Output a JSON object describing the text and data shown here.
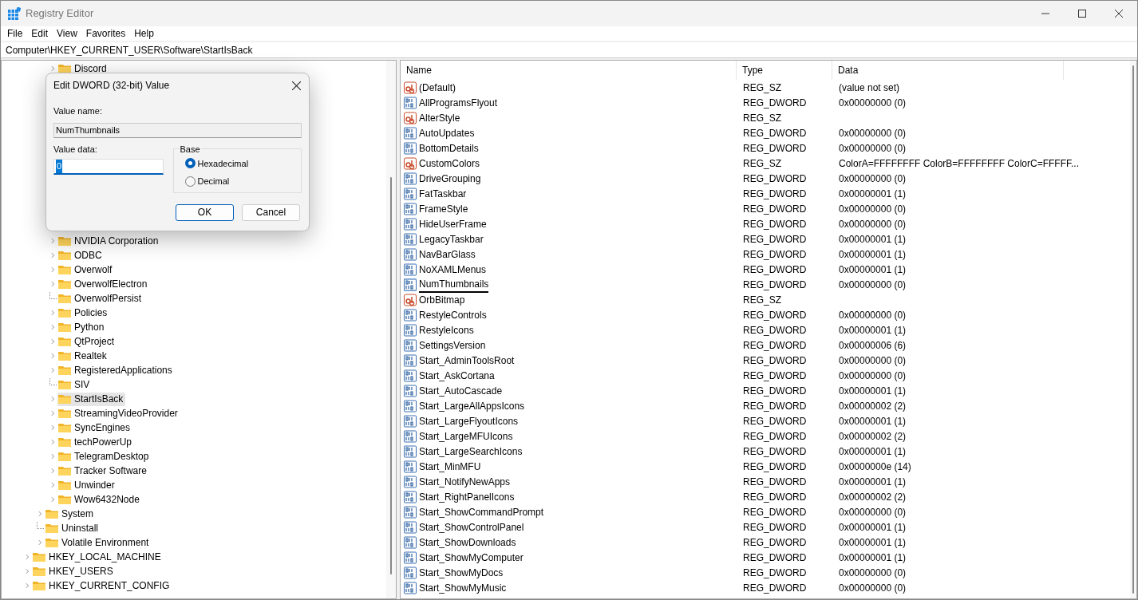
{
  "window": {
    "title": "Registry Editor"
  },
  "menu": [
    "File",
    "Edit",
    "View",
    "Favorites",
    "Help"
  ],
  "address": "Computer\\HKEY_CURRENT_USER\\Software\\StartIsBack",
  "tree": {
    "items": [
      {
        "children": [
          {
            "children": [
              {
                "label": "Discord",
                "expandable": true,
                "selected": false
              },
              {
                "label": "NVIDIA Corporation",
                "expandable": true,
                "selected": false
              },
              {
                "label": "ODBC",
                "expandable": true,
                "selected": false
              },
              {
                "label": "Overwolf",
                "expandable": true,
                "selected": false
              },
              {
                "label": "OverwolfElectron",
                "expandable": true,
                "selected": false
              },
              {
                "label": "OverwolfPersist",
                "expandable": false,
                "selected": false
              },
              {
                "label": "Policies",
                "expandable": true,
                "selected": false
              },
              {
                "label": "Python",
                "expandable": true,
                "selected": false
              },
              {
                "label": "QtProject",
                "expandable": true,
                "selected": false
              },
              {
                "label": "Realtek",
                "expandable": true,
                "selected": false
              },
              {
                "label": "RegisteredApplications",
                "expandable": true,
                "selected": false
              },
              {
                "label": "SIV",
                "expandable": false,
                "selected": false
              },
              {
                "label": "StartIsBack",
                "expandable": true,
                "selected": true
              },
              {
                "label": "StreamingVideoProvider",
                "expandable": true,
                "selected": false
              },
              {
                "label": "SyncEngines",
                "expandable": true,
                "selected": false
              },
              {
                "label": "techPowerUp",
                "expandable": true,
                "selected": false
              },
              {
                "label": "TelegramDesktop",
                "expandable": true,
                "selected": false
              },
              {
                "label": "Tracker Software",
                "expandable": true,
                "selected": false
              },
              {
                "label": "Unwinder",
                "expandable": true,
                "selected": false
              },
              {
                "label": "Wow6432Node",
                "expandable": true,
                "selected": false
              }
            ]
          },
          {
            "label": "System",
            "expandable": true,
            "selected": false
          },
          {
            "label": "Uninstall",
            "expandable": false,
            "selected": false
          },
          {
            "label": "Volatile Environment",
            "expandable": true,
            "selected": false
          }
        ]
      },
      {
        "label": "HKEY_LOCAL_MACHINE",
        "expandable": true,
        "selected": false
      },
      {
        "label": "HKEY_USERS",
        "expandable": true,
        "selected": false
      },
      {
        "label": "HKEY_CURRENT_CONFIG",
        "expandable": true,
        "selected": false
      }
    ]
  },
  "values": {
    "columns": [
      "Name",
      "Type",
      "Data"
    ],
    "rows": [
      {
        "kind": "sz",
        "name": "(Default)",
        "type": "REG_SZ",
        "data": "(value not set)",
        "focused": false,
        "underlined": false
      },
      {
        "kind": "dword",
        "name": "AllProgramsFlyout",
        "type": "REG_DWORD",
        "data": "0x00000000 (0)",
        "focused": false,
        "underlined": false
      },
      {
        "kind": "sz",
        "name": "AlterStyle",
        "type": "REG_SZ",
        "focused": false,
        "underlined": false
      },
      {
        "kind": "dword",
        "name": "AutoUpdates",
        "type": "REG_DWORD",
        "data": "0x00000000 (0)",
        "focused": false,
        "underlined": false
      },
      {
        "kind": "dword",
        "name": "BottomDetails",
        "type": "REG_DWORD",
        "data": "0x00000000 (0)",
        "focused": false,
        "underlined": false
      },
      {
        "kind": "sz",
        "name": "CustomColors",
        "type": "REG_SZ",
        "data": "ColorA=FFFFFFFF ColorB=FFFFFFFF ColorC=FFFFF...",
        "focused": false,
        "underlined": false
      },
      {
        "kind": "dword",
        "name": "DriveGrouping",
        "type": "REG_DWORD",
        "data": "0x00000000 (0)",
        "focused": false,
        "underlined": false
      },
      {
        "kind": "dword",
        "name": "FatTaskbar",
        "type": "REG_DWORD",
        "data": "0x00000001 (1)",
        "focused": false,
        "underlined": false
      },
      {
        "kind": "dword",
        "name": "FrameStyle",
        "type": "REG_DWORD",
        "data": "0x00000000 (0)",
        "focused": false,
        "underlined": false
      },
      {
        "kind": "dword",
        "name": "HideUserFrame",
        "type": "REG_DWORD",
        "data": "0x00000000 (0)",
        "focused": false,
        "underlined": false
      },
      {
        "kind": "dword",
        "name": "LegacyTaskbar",
        "type": "REG_DWORD",
        "data": "0x00000001 (1)",
        "focused": false,
        "underlined": false
      },
      {
        "kind": "dword",
        "name": "NavBarGlass",
        "type": "REG_DWORD",
        "data": "0x00000001 (1)",
        "focused": false,
        "underlined": false
      },
      {
        "kind": "dword",
        "name": "NoXAMLMenus",
        "type": "REG_DWORD",
        "data": "0x00000001 (1)",
        "focused": false,
        "underlined": false
      },
      {
        "kind": "dword",
        "name": "NumThumbnails",
        "type": "REG_DWORD",
        "data": "0x00000000 (0)",
        "focused": true,
        "underlined": true
      },
      {
        "kind": "sz",
        "name": "OrbBitmap",
        "type": "REG_SZ",
        "focused": false,
        "underlined": false
      },
      {
        "kind": "dword",
        "name": "RestyleControls",
        "type": "REG_DWORD",
        "data": "0x00000000 (0)",
        "focused": false,
        "underlined": false
      },
      {
        "kind": "dword",
        "name": "RestyleIcons",
        "type": "REG_DWORD",
        "data": "0x00000001 (1)",
        "focused": false,
        "underlined": false
      },
      {
        "kind": "dword",
        "name": "SettingsVersion",
        "type": "REG_DWORD",
        "data": "0x00000006 (6)",
        "focused": false,
        "underlined": false
      },
      {
        "kind": "dword",
        "name": "Start_AdminToolsRoot",
        "type": "REG_DWORD",
        "data": "0x00000000 (0)",
        "focused": false,
        "underlined": false
      },
      {
        "kind": "dword",
        "name": "Start_AskCortana",
        "type": "REG_DWORD",
        "data": "0x00000000 (0)",
        "focused": false,
        "underlined": false
      },
      {
        "kind": "dword",
        "name": "Start_AutoCascade",
        "type": "REG_DWORD",
        "data": "0x00000001 (1)",
        "focused": false,
        "underlined": false
      },
      {
        "kind": "dword",
        "name": "Start_LargeAllAppsIcons",
        "type": "REG_DWORD",
        "data": "0x00000002 (2)",
        "focused": false,
        "underlined": false
      },
      {
        "kind": "dword",
        "name": "Start_LargeFlyoutIcons",
        "type": "REG_DWORD",
        "data": "0x00000001 (1)",
        "focused": false,
        "underlined": false
      },
      {
        "kind": "dword",
        "name": "Start_LargeMFUIcons",
        "type": "REG_DWORD",
        "data": "0x00000002 (2)",
        "focused": false,
        "underlined": false
      },
      {
        "kind": "dword",
        "name": "Start_LargeSearchIcons",
        "type": "REG_DWORD",
        "data": "0x00000001 (1)",
        "focused": false,
        "underlined": false
      },
      {
        "kind": "dword",
        "name": "Start_MinMFU",
        "type": "REG_DWORD",
        "data": "0x0000000e (14)",
        "focused": false,
        "underlined": false
      },
      {
        "kind": "dword",
        "name": "Start_NotifyNewApps",
        "type": "REG_DWORD",
        "data": "0x00000001 (1)",
        "focused": false,
        "underlined": false
      },
      {
        "kind": "dword",
        "name": "Start_RightPanelIcons",
        "type": "REG_DWORD",
        "data": "0x00000002 (2)",
        "focused": false,
        "underlined": false
      },
      {
        "kind": "dword",
        "name": "Start_ShowCommandPrompt",
        "type": "REG_DWORD",
        "data": "0x00000000 (0)",
        "focused": false,
        "underlined": false
      },
      {
        "kind": "dword",
        "name": "Start_ShowControlPanel",
        "type": "REG_DWORD",
        "data": "0x00000001 (1)",
        "focused": false,
        "underlined": false
      },
      {
        "kind": "dword",
        "name": "Start_ShowDownloads",
        "type": "REG_DWORD",
        "data": "0x00000001 (1)",
        "focused": false,
        "underlined": false
      },
      {
        "kind": "dword",
        "name": "Start_ShowMyComputer",
        "type": "REG_DWORD",
        "data": "0x00000001 (1)",
        "focused": false,
        "underlined": false
      },
      {
        "kind": "dword",
        "name": "Start_ShowMyDocs",
        "type": "REG_DWORD",
        "data": "0x00000000 (0)",
        "focused": false,
        "underlined": false
      },
      {
        "kind": "dword",
        "name": "Start_ShowMyMusic",
        "type": "REG_DWORD",
        "data": "0x00000000 (0)",
        "focused": false,
        "underlined": false
      }
    ]
  },
  "dialog": {
    "title": "Edit DWORD (32-bit) Value",
    "value_name_label": "Value name:",
    "value_name": "NumThumbnails",
    "value_data_label": "Value data:",
    "value_data": "0",
    "base_label": "Base",
    "base_options": [
      {
        "label": "Hexadecimal",
        "selected": true
      },
      {
        "label": "Decimal",
        "selected": false
      }
    ],
    "buttons": [
      {
        "label": "OK",
        "default": true
      },
      {
        "label": "Cancel",
        "default": false
      }
    ]
  }
}
